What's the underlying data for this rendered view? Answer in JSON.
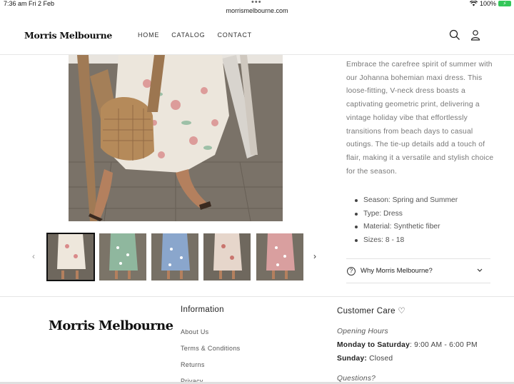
{
  "status": {
    "time": "7:36 am",
    "date": "Fri 2 Feb",
    "url": "morrismelbourne.com",
    "battery": "100%"
  },
  "header": {
    "logo": "Morris Melbourne",
    "nav": [
      "HOME",
      "CATALOG",
      "CONTACT"
    ]
  },
  "product": {
    "description": "Embrace the carefree spirit of summer with our Johanna bohemian maxi dress. This loose-fitting, V-neck dress boasts a captivating geometric print, delivering a vintage holiday vibe that effortlessly transitions from beach days to casual outings. The tie-up details add a touch of flair, making it a versatile and stylish choice for the season.",
    "specs": [
      "Season: Spring and Summer",
      "Type: Dress",
      "Material: Synthetic fiber",
      "Sizes: 8 - 18"
    ],
    "accordion_label": "Why Morris Melbourne?",
    "prev_arrow": "‹",
    "next_arrow": "›",
    "thumbnail_colors": [
      "#d9cfc3",
      "#8fb79e",
      "#8aa6cc",
      "#d8b8a8",
      "#d99f9f"
    ]
  },
  "footer": {
    "logo": "Morris Melbourne",
    "information_heading": "Information",
    "links": [
      "About Us",
      "Terms & Conditions",
      "Returns",
      "Privacy"
    ],
    "customer_care_heading": "Customer Care ♡",
    "opening_hours_label": "Opening Hours",
    "weekday_label": "Monday to Saturday",
    "weekday_hours": ": 9:00 AM - 6:00 PM",
    "sunday_label": "Sunday:",
    "sunday_hours": " Closed",
    "questions_label": "Questions?"
  }
}
